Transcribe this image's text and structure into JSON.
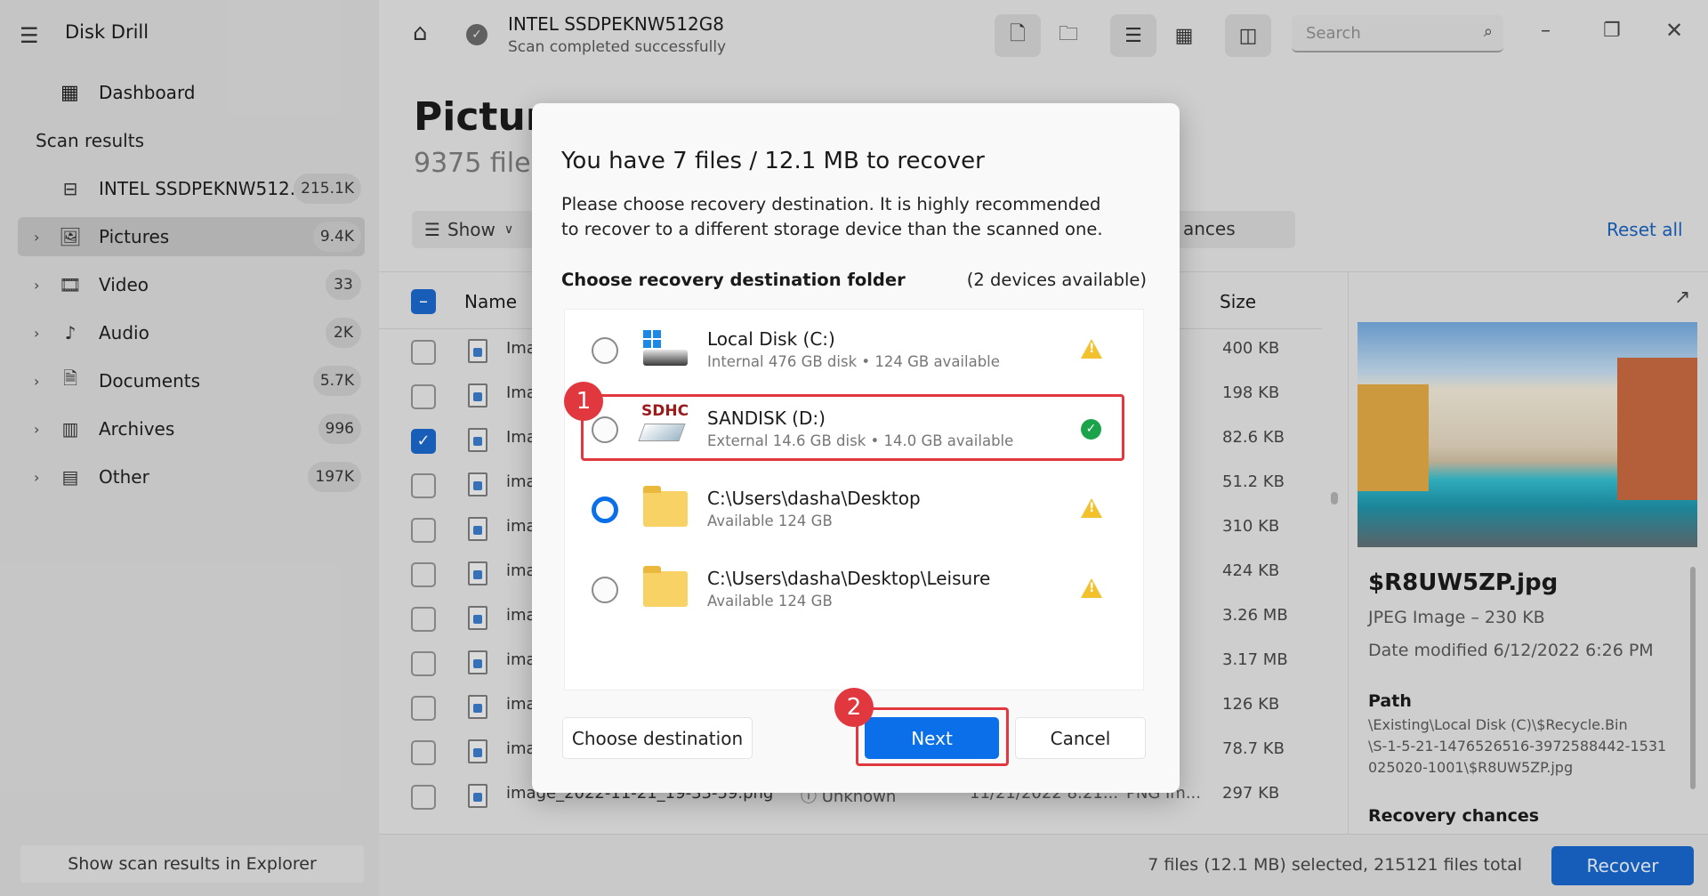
{
  "app": {
    "title": "Disk Drill"
  },
  "sidebar": {
    "dashboard": "Dashboard",
    "scan_results_heading": "Scan results",
    "items": [
      {
        "label": "INTEL SSDPEKNW512...",
        "count": "215.1K",
        "icon": "drive-icon"
      },
      {
        "label": "Pictures",
        "count": "9.4K",
        "icon": "image-icon",
        "selected": true
      },
      {
        "label": "Video",
        "count": "33",
        "icon": "film-icon"
      },
      {
        "label": "Audio",
        "count": "2K",
        "icon": "music-icon"
      },
      {
        "label": "Documents",
        "count": "5.7K",
        "icon": "document-icon"
      },
      {
        "label": "Archives",
        "count": "996",
        "icon": "archive-icon"
      },
      {
        "label": "Other",
        "count": "197K",
        "icon": "other-icon"
      }
    ],
    "show_in_explorer": "Show scan results in Explorer"
  },
  "header": {
    "device": "INTEL SSDPEKNW512G8",
    "status": "Scan completed successfully",
    "search_placeholder": "Search"
  },
  "main": {
    "title": "Picture",
    "subtitle": "9375 files",
    "show_label": "Show",
    "chances_fragment": "ances",
    "reset_all": "Reset all",
    "columns": {
      "name": "Name",
      "size": "Size"
    },
    "rows": [
      {
        "name": "Ima",
        "size": "400 KB",
        "checked": false
      },
      {
        "name": "Ima",
        "size": "198 KB",
        "checked": false
      },
      {
        "name": "Ima",
        "size": "82.6 KB",
        "checked": true
      },
      {
        "name": "ima",
        "size": "51.2 KB",
        "checked": false
      },
      {
        "name": "ima",
        "size": "310 KB",
        "checked": false
      },
      {
        "name": "ima",
        "size": "424 KB",
        "checked": false
      },
      {
        "name": "ima",
        "size": "3.26 MB",
        "checked": false
      },
      {
        "name": "ima",
        "size": "3.17 MB",
        "checked": false
      },
      {
        "name": "ima",
        "size": "126 KB",
        "checked": false
      },
      {
        "name": "ima",
        "size": "78.7 KB",
        "checked": false
      },
      {
        "name": "image_2022-11-21_19-33-59.png",
        "chances": "Unknown",
        "date": "11/21/2022 8:21...",
        "type": "PNG Im...",
        "size": "297 KB",
        "checked": false
      }
    ]
  },
  "preview": {
    "filename": "$R8UW5ZP.jpg",
    "type_size": "JPEG Image – 230 KB",
    "date_modified": "Date modified 6/12/2022 6:26 PM",
    "path_label": "Path",
    "path_lines": [
      "\\Existing\\Local Disk (C)\\$Recycle.Bin",
      "\\S-1-5-21-1476526516-3972588442-1531",
      "025020-1001\\$R8UW5ZP.jpg"
    ],
    "recovery_chances": "Recovery chances"
  },
  "footer": {
    "status": "7 files (12.1 MB) selected, 215121 files total",
    "recover": "Recover"
  },
  "dialog": {
    "title": "You have 7 files / 12.1 MB to recover",
    "description": "Please choose recovery destination. It is highly recommended to recover to a different storage device than the scanned one.",
    "section": "Choose recovery destination folder",
    "devices_available": "(2 devices available)",
    "destinations": [
      {
        "name": "Local Disk (C:)",
        "detail": "Internal 476 GB disk • 124 GB available",
        "status": "warning"
      },
      {
        "name": "SANDISK (D:)",
        "detail": "External 14.6 GB disk • 14.0 GB available",
        "status": "ok",
        "icon_text": "SDHC"
      },
      {
        "name": "C:\\Users\\dasha\\Desktop",
        "detail": "Available 124 GB",
        "status": "warning"
      },
      {
        "name": "C:\\Users\\dasha\\Desktop\\Leisure",
        "detail": "Available 124 GB",
        "status": "warning"
      }
    ],
    "choose_destination": "Choose destination",
    "next": "Next",
    "cancel": "Cancel",
    "annotations": [
      "1",
      "2"
    ]
  },
  "colors": {
    "accent": "#0a6fe8",
    "annotation": "#e0383e",
    "ok": "#1aa34a",
    "warning": "#f2c12e"
  }
}
